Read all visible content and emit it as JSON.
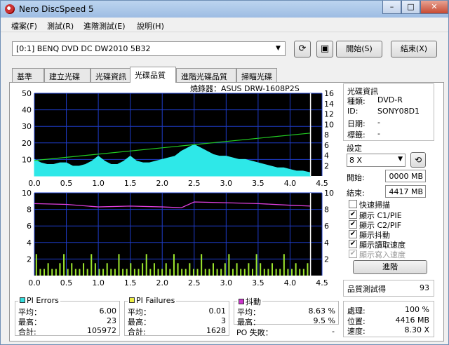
{
  "window": {
    "title": "Nero DiscSpeed 5"
  },
  "menu": [
    "檔案(F)",
    "測試(R)",
    "進階測試(E)",
    "說明(H)"
  ],
  "toolbar": {
    "drive": "[0:1]   BENQ DVD DC DW2010 5B32",
    "start_label": "開始(S)",
    "close_label": "結束(X)"
  },
  "tabs": [
    "基準",
    "建立光碟",
    "光碟資訊",
    "光碟品質",
    "進階光碟品質",
    "掃瞄光碟"
  ],
  "active_tab": "光碟品質",
  "recorder": "燒錄器：ASUS    DRW-1608P2S",
  "disc_info": {
    "header": "光碟資訊",
    "rows": [
      {
        "label": "種類:",
        "value": "DVD-R"
      },
      {
        "label": "ID:",
        "value": "SONY08D1"
      },
      {
        "label": "日期:",
        "value": "-"
      },
      {
        "label": "標籤:",
        "value": "-"
      }
    ]
  },
  "settings": {
    "header": "設定",
    "speed": "8 X",
    "start_label": "開始:",
    "start_value": "0000 MB",
    "end_label": "結束:",
    "end_value": "4417 MB",
    "checkboxes": [
      {
        "label": "快速掃描",
        "checked": false,
        "enabled": true
      },
      {
        "label": "顯示 C1/PIE",
        "checked": true,
        "enabled": true
      },
      {
        "label": "顯示 C2/PIF",
        "checked": true,
        "enabled": true
      },
      {
        "label": "顯示抖動",
        "checked": true,
        "enabled": true
      },
      {
        "label": "顯示讀取速度",
        "checked": true,
        "enabled": true
      },
      {
        "label": "顯示寫入速度",
        "checked": true,
        "enabled": false
      }
    ],
    "advanced_label": "進階"
  },
  "quality": {
    "label": "品質測試得",
    "score": "93"
  },
  "progress": {
    "rows": [
      {
        "label": "處理:",
        "value": "100 %"
      },
      {
        "label": "位置:",
        "value": "4416 MB"
      },
      {
        "label": "速度:",
        "value": "8.30 X"
      }
    ]
  },
  "stats": {
    "pi_errors": {
      "title": "PI Errors",
      "color": "#33dddd",
      "rows": [
        {
          "label": "平均：",
          "value": "6.00"
        },
        {
          "label": "最高：",
          "value": "23"
        },
        {
          "label": "合計:",
          "value": "105972"
        }
      ]
    },
    "pi_failures": {
      "title": "PI Failures",
      "color": "#eeee44",
      "rows": [
        {
          "label": "平均：",
          "value": "0.01"
        },
        {
          "label": "最高：",
          "value": "3"
        },
        {
          "label": "合計:",
          "value": "1628"
        }
      ]
    },
    "jitter": {
      "title": "抖動",
      "color": "#cc33cc",
      "rows": [
        {
          "label": "平均：",
          "value": "8.63 %"
        },
        {
          "label": "最高：",
          "value": "9.5 %"
        }
      ]
    },
    "po_failures": {
      "label": "PO 失敗：",
      "value": "-"
    }
  },
  "chart_data": [
    {
      "type": "area",
      "name": "PI Errors",
      "x_ticks": [
        "0.0",
        "0.5",
        "1.0",
        "1.5",
        "2.0",
        "2.5",
        "3.0",
        "3.5",
        "4.0",
        "4.5"
      ],
      "y_left_ticks": [
        "10",
        "20",
        "30",
        "40",
        "50"
      ],
      "y_right_ticks": [
        "2",
        "4",
        "6",
        "8",
        "10",
        "12",
        "14",
        "16"
      ],
      "xlim": [
        0,
        4.5
      ],
      "ylim": [
        0,
        50
      ],
      "y2lim": [
        0,
        16
      ],
      "series": [
        {
          "values_x": [
            0,
            0.1,
            0.2,
            0.3,
            0.4,
            0.5,
            0.6,
            0.7,
            0.8,
            0.9,
            1.0,
            1.1,
            1.2,
            1.3,
            1.4,
            1.5,
            1.6,
            1.7,
            1.8,
            1.9,
            2.0,
            2.1,
            2.2,
            2.3,
            2.4,
            2.5,
            2.6,
            2.7,
            2.8,
            2.9,
            3.0,
            3.1,
            3.2,
            3.3,
            3.4,
            3.5,
            3.6,
            3.7,
            3.8,
            3.9,
            4.0,
            4.1,
            4.2,
            4.32
          ],
          "values": [
            10,
            8,
            7,
            7,
            8,
            8,
            6,
            6,
            7,
            9,
            12,
            9,
            7,
            7,
            9,
            12,
            9,
            8,
            8,
            9,
            10,
            11,
            12,
            15,
            17,
            19,
            17,
            15,
            13,
            12,
            12,
            11,
            10,
            10,
            9,
            8,
            7,
            6,
            5,
            5,
            4,
            3,
            3,
            2
          ]
        },
        {
          "values_x": [
            0,
            4.32
          ],
          "values": [
            3.0,
            8.3
          ]
        }
      ]
    },
    {
      "type": "bar",
      "name": "PI Failures",
      "x_ticks": [
        "0.0",
        "0.5",
        "1.0",
        "1.5",
        "2.0",
        "2.5",
        "3.0",
        "3.5",
        "4.0",
        "4.5"
      ],
      "y_left_ticks": [
        "2",
        "4",
        "6",
        "8",
        "10"
      ],
      "y_right_ticks": [
        "2",
        "4",
        "6",
        "8",
        "10"
      ],
      "xlim": [
        0,
        4.5
      ],
      "ylim": [
        0,
        10
      ],
      "series": [
        {
          "values_x": [
            0,
            0.5,
            1.0,
            1.5,
            2.0,
            2.3,
            2.5,
            3.0,
            3.5,
            4.0,
            4.32
          ],
          "values": [
            8.7,
            8.6,
            8.3,
            8.4,
            8.3,
            8.2,
            8.9,
            8.8,
            8.7,
            8.5,
            8.4
          ]
        }
      ]
    }
  ]
}
